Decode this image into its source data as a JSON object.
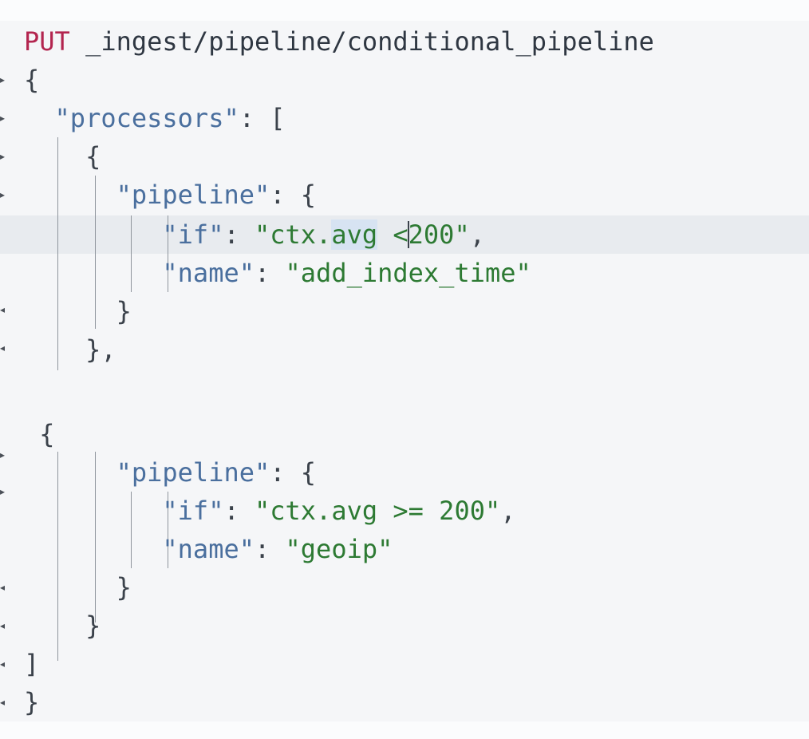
{
  "request": {
    "method": "PUT",
    "path": "_ingest/pipeline/conditional_pipeline"
  },
  "body": {
    "processors_key": "\"processors\"",
    "first_processor": {
      "pipeline_key": "\"pipeline\"",
      "if_key": "\"if\"",
      "if_value_prefix": "\"ctx.",
      "if_value_highlight": "avg",
      "if_value_before_cursor": " <",
      "if_value_after_cursor": "200\"",
      "name_key": "\"name\"",
      "name_value": "\"add_index_time\""
    },
    "second_processor": {
      "pipeline_key": "\"pipeline\"",
      "if_key": "\"if\"",
      "if_value": "\"ctx.avg >= 200\"",
      "name_key": "\"name\"",
      "name_value": "\"geoip\""
    }
  },
  "colors": {
    "method": "#b3254f",
    "key": "#4a6f9e",
    "string": "#2d7a33",
    "active_line": "#e8ebef",
    "selection": "#d7e3f2"
  },
  "icons": {
    "fold_marker": "fold-arrow-icon"
  }
}
